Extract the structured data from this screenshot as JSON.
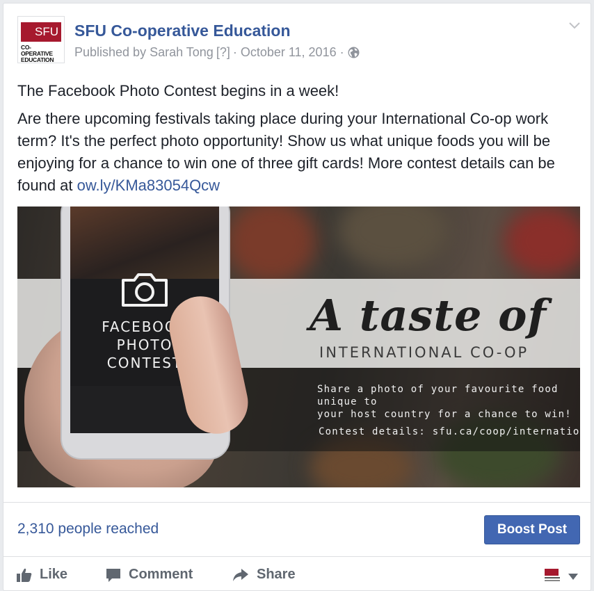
{
  "post": {
    "page_name": "SFU Co-operative Education",
    "published_by": "Published by Sarah Tong",
    "help_marker": "[?]",
    "date": "October 11, 2016",
    "separator": "·",
    "headline": "The Facebook Photo Contest begins in a week!",
    "body": "Are there upcoming festivals taking place during your International Co-op work term? It's the perfect photo opportunity! Show us what unique foods you will be enjoying for a chance to win one of three gift cards! More contest details can be found at ",
    "link_text": "ow.ly/KMa83054Qcw"
  },
  "avatar": {
    "logo_text": "SFU",
    "logo_sub": "CO-OPERATIVE EDUCATION"
  },
  "image": {
    "screen_text_1": "FACEBOOK",
    "screen_text_2": "PHOTO",
    "screen_text_3": "CONTEST",
    "tagline": "A taste of",
    "subtitle": "INTERNATIONAL CO-OP",
    "promo_line_1": "Share a photo of your favourite food unique to",
    "promo_line_2": "your host country for a chance to win!",
    "details": "Contest details:  sfu.ca/coop/international/"
  },
  "stats": {
    "reach": "2,310 people reached",
    "boost_label": "Boost Post"
  },
  "actions": {
    "like": "Like",
    "comment": "Comment",
    "share": "Share"
  },
  "colors": {
    "link": "#365899",
    "boost": "#4267b2",
    "brand_red": "#a6192e"
  },
  "icons": [
    "globe-icon",
    "chevron-down-icon",
    "camera-icon",
    "like-icon",
    "comment-icon",
    "share-icon",
    "caret-down-icon"
  ]
}
